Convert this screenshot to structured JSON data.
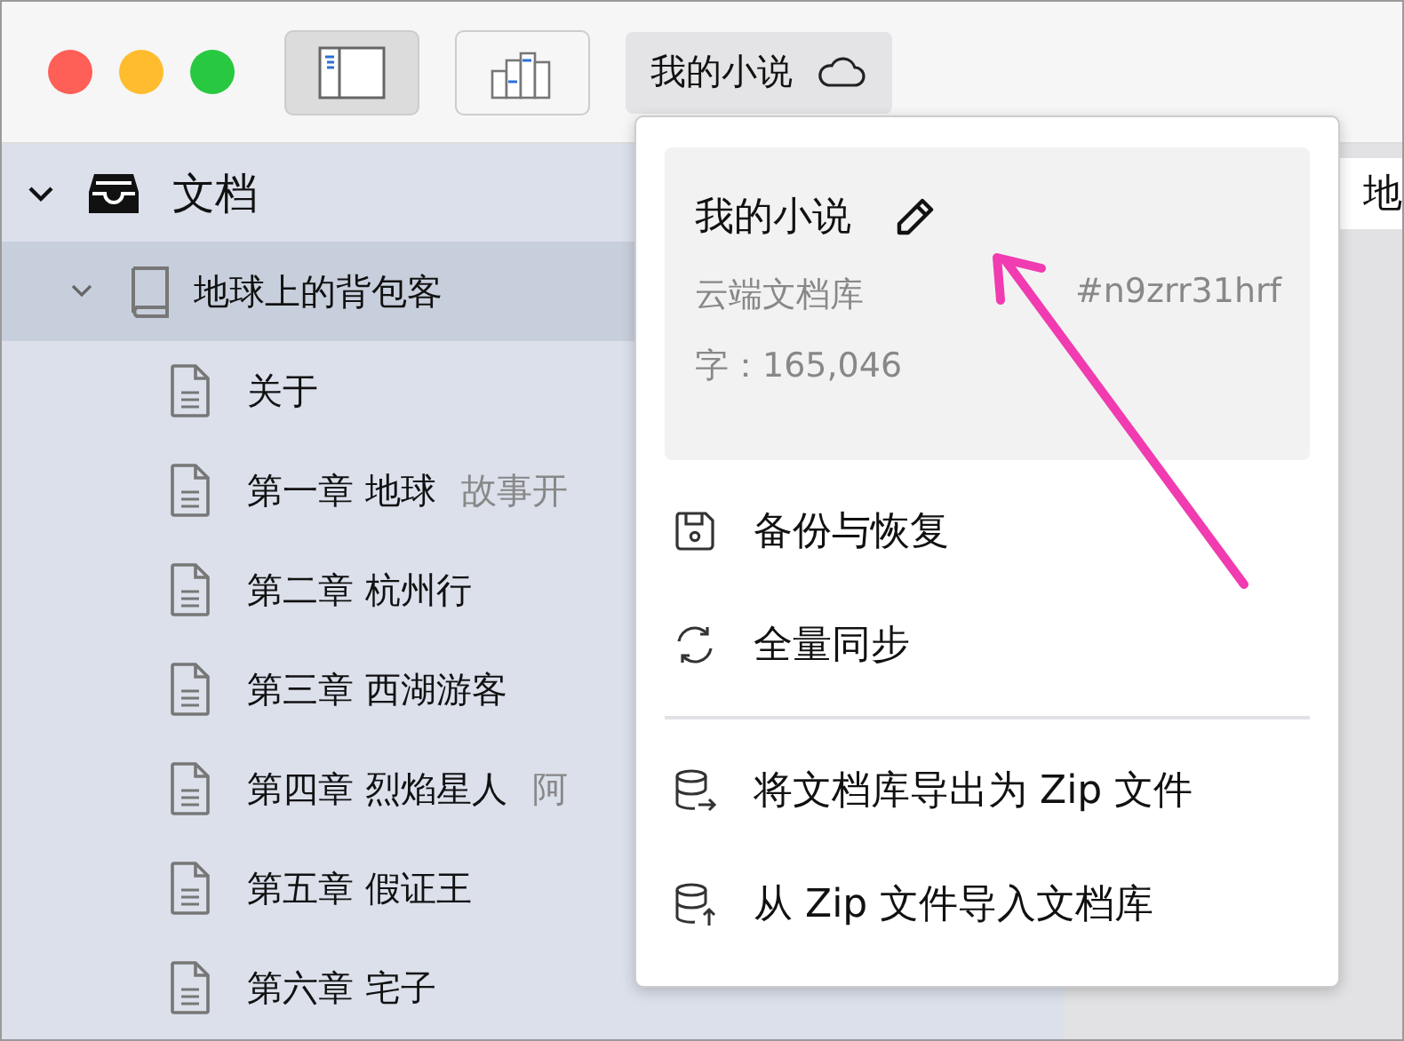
{
  "toolbar": {
    "buttons": [
      {
        "kind": "sidebar",
        "pressed": true
      },
      {
        "kind": "chart",
        "pressed": false
      }
    ],
    "library_button": {
      "label": "我的小说"
    }
  },
  "sidebar": {
    "items": [
      {
        "label": "文档",
        "kind": "inbox",
        "expanded": true,
        "children": [
          {
            "label": "地球上的背包客",
            "kind": "book",
            "expanded": true,
            "selected": true,
            "children": [
              {
                "label": "关于",
                "kind": "doc",
                "selected": false
              },
              {
                "label": "第一章 地球",
                "note": "故事开",
                "kind": "doc",
                "selected": false
              },
              {
                "label": "第二章 杭州行",
                "kind": "doc",
                "selected": false
              },
              {
                "label": "第三章 西湖游客",
                "kind": "doc",
                "selected": false
              },
              {
                "label": "第四章 烈焰星人",
                "note": "阿",
                "kind": "doc",
                "selected": false
              },
              {
                "label": "第五章 假证王",
                "kind": "doc",
                "selected": false
              },
              {
                "label": "第六章 宅子",
                "kind": "doc",
                "selected": false
              }
            ]
          }
        ]
      }
    ]
  },
  "editor": {
    "title": "地"
  },
  "menu": {
    "info": {
      "name": "我的小说",
      "type": "云端文档库",
      "id": "#n9zrr31hrf",
      "count": "字：165,046"
    },
    "sections": [
      [
        {
          "label": "备份与恢复",
          "kind": "save"
        },
        {
          "label": "全量同步",
          "kind": "sync"
        }
      ],
      [
        {
          "label": "将文档库导出为 Zip 文件",
          "kind": "export"
        },
        {
          "label": "从 Zip 文件导入文档库",
          "kind": "import"
        }
      ]
    ]
  }
}
